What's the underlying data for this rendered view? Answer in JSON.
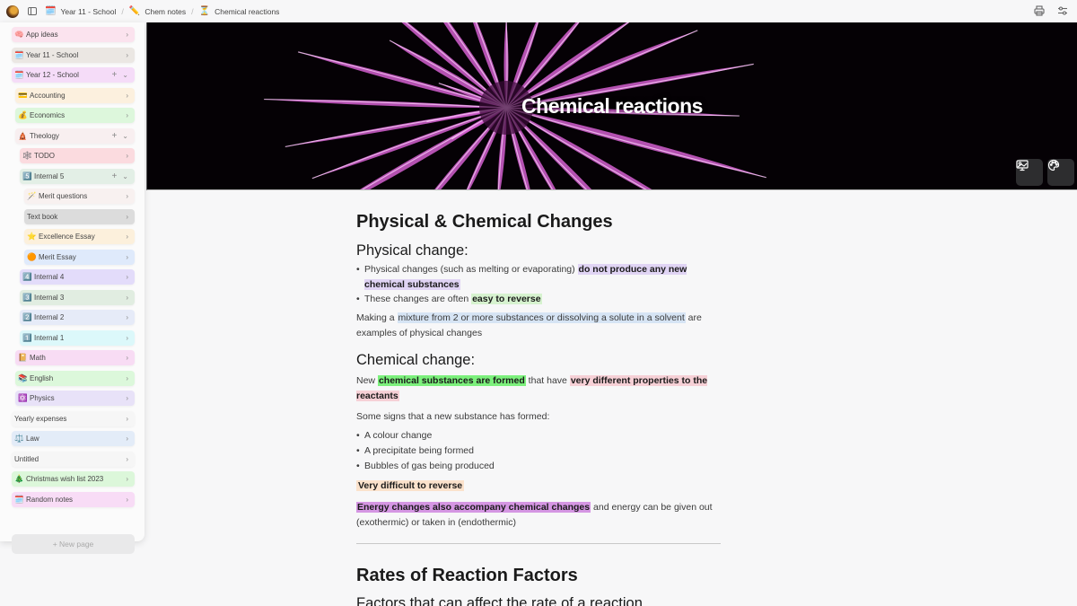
{
  "topbar": {
    "breadcrumbs": [
      {
        "icon": "🗓️",
        "label": "Year 11 - School"
      },
      {
        "icon": "✏️",
        "label": "Chem notes"
      },
      {
        "icon": "⏳",
        "label": "Chemical reactions"
      }
    ],
    "actions": [
      "print-icon",
      "sliders-icon"
    ]
  },
  "sidebar": {
    "items": [
      {
        "icon": "🧠",
        "label": "App ideas",
        "level": 0,
        "bg": "#fbe3ee",
        "expanded": false,
        "has_add": false
      },
      {
        "icon": "🗓️",
        "label": "Year 11 - School",
        "level": 0,
        "bg": "#ebe7e3",
        "expanded": false,
        "has_add": false
      },
      {
        "icon": "🗓️",
        "label": "Year 12 - School",
        "level": 0,
        "bg": "#f5dcf8",
        "expanded": true,
        "has_add": true
      },
      {
        "icon": "💳",
        "label": "Accounting",
        "level": 1,
        "bg": "#fcf0de",
        "expanded": false,
        "has_add": false
      },
      {
        "icon": "💰",
        "label": "Economics",
        "level": 1,
        "bg": "#ddf7dc",
        "expanded": false,
        "has_add": false
      },
      {
        "icon": "🛕",
        "label": "Theology",
        "level": 1,
        "bg": "#f8eff0",
        "expanded": true,
        "has_add": true
      },
      {
        "icon": "🕸️",
        "label": "TODO",
        "level": 2,
        "bg": "#fbdbdf",
        "expanded": false,
        "has_add": false
      },
      {
        "icon": "5️⃣",
        "label": "Internal 5",
        "level": 2,
        "bg": "#e3efe6",
        "expanded": true,
        "has_add": true
      },
      {
        "icon": "🪄",
        "label": "Merit questions",
        "level": 3,
        "bg": "#f8f1f0",
        "expanded": false,
        "has_add": false
      },
      {
        "icon": "",
        "label": "Text book",
        "level": 3,
        "bg": "#dcdcdc",
        "expanded": false,
        "has_add": false
      },
      {
        "icon": "⭐",
        "label": "Excellence Essay",
        "level": 3,
        "bg": "#fcf0dc",
        "expanded": false,
        "has_add": false
      },
      {
        "icon": "🟠",
        "label": "Merit Essay",
        "level": 3,
        "bg": "#dfeafb",
        "expanded": false,
        "has_add": false
      },
      {
        "icon": "4️⃣",
        "label": "Internal 4",
        "level": 2,
        "bg": "#e3dcfa",
        "expanded": false,
        "has_add": false
      },
      {
        "icon": "3️⃣",
        "label": "Internal 3",
        "level": 2,
        "bg": "#e1ede1",
        "expanded": false,
        "has_add": false
      },
      {
        "icon": "2️⃣",
        "label": "Internal 2",
        "level": 2,
        "bg": "#e6ebf8",
        "expanded": false,
        "has_add": false
      },
      {
        "icon": "1️⃣",
        "label": "Internal 1",
        "level": 2,
        "bg": "#dcf8fa",
        "expanded": false,
        "has_add": false
      },
      {
        "icon": "📔",
        "label": "Math",
        "level": 1,
        "bg": "#f8dcf4",
        "expanded": false,
        "has_add": false
      },
      {
        "icon": "📚",
        "label": "English",
        "level": 1,
        "bg": "#dcf8db",
        "expanded": false,
        "has_add": false
      },
      {
        "icon": "⚛️",
        "label": "Physics",
        "level": 1,
        "bg": "#e8e2f8",
        "expanded": false,
        "has_add": false
      },
      {
        "icon": "",
        "label": "Yearly expenses",
        "level": 0,
        "bg": "#f6f6f6",
        "expanded": false,
        "has_add": false
      },
      {
        "icon": "⚖️",
        "label": "Law",
        "level": 0,
        "bg": "#e3ecf8",
        "expanded": false,
        "has_add": false
      },
      {
        "icon": "",
        "label": "Untitled",
        "level": 0,
        "bg": "#f6f6f6",
        "expanded": false,
        "has_add": false
      },
      {
        "icon": "🎄",
        "label": "Christmas wish list 2023",
        "level": 0,
        "bg": "#dcf7da",
        "expanded": false,
        "has_add": false
      },
      {
        "icon": "🗓️",
        "label": "Random notes",
        "level": 0,
        "bg": "#f8dcf6",
        "expanded": false,
        "has_add": false
      }
    ],
    "new_page_label": "+ New page"
  },
  "cover": {
    "title": "Chemical reactions",
    "buttons": [
      "change-cover-icon",
      "palette-icon"
    ]
  },
  "doc": {
    "h1": "Physical & Chemical Changes",
    "physical_heading": "Physical change:",
    "physical_bullets": [
      {
        "pre": "Physical changes (such as melting or evaporating) ",
        "hl": "do not produce any new chemical substances",
        "post": ""
      },
      {
        "pre": "These changes are often ",
        "hl": "easy to reverse",
        "post": ""
      }
    ],
    "mixture_para": {
      "pre": "Making a ",
      "hl": "mixture from 2 or more substances or dissolving a solute in a solvent",
      "post": " are examples of physical changes"
    },
    "chemical_heading": "Chemical change:",
    "chemical_para": {
      "pre": "New ",
      "hl1": "chemical substances are formed",
      "mid": " that have ",
      "hl2": "very different properties to the reactants"
    },
    "signs_intro": "Some signs that a new substance has formed:",
    "signs": [
      "A colour change",
      "A precipitate being formed",
      "Bubbles of gas being produced"
    ],
    "difficult": "Very difficult to reverse",
    "energy_para": {
      "hl": "Energy changes also accompany chemical changes",
      "post": " and energy can be given out (exothermic) or taken in (endothermic)"
    },
    "rates_heading": "Rates of Reaction Factors",
    "rates_sub": "Factors that can affect the rate of a reaction"
  },
  "colors": {
    "hl_purple": "#e0d4f4",
    "hl_green": "#d6f2cf",
    "hl_blue": "#d6e4f4",
    "hl_brightgreen": "#7cf07c",
    "hl_pink": "#f6d0d6",
    "hl_peach": "#fbe2cc",
    "hl_violet": "#d596e3"
  }
}
